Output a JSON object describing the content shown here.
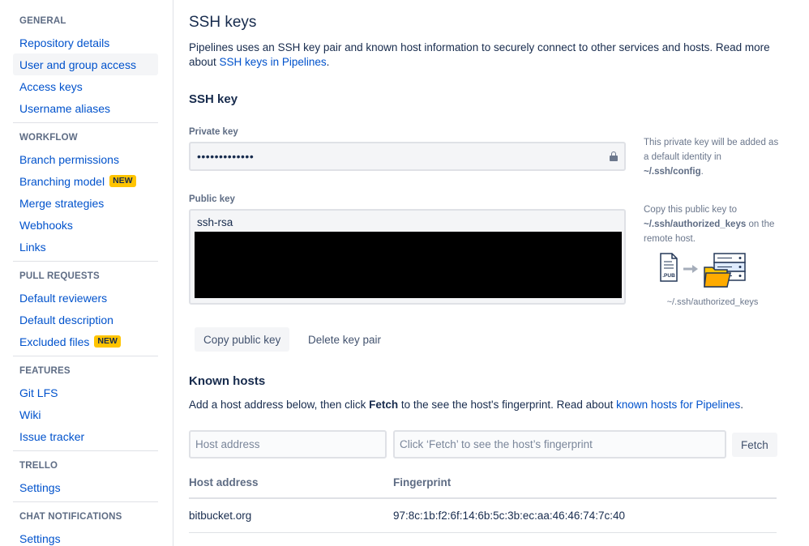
{
  "sidebar": {
    "sections": [
      {
        "heading": "GENERAL",
        "items": [
          {
            "label": "Repository details"
          },
          {
            "label": "User and group access",
            "selected": true
          },
          {
            "label": "Access keys"
          },
          {
            "label": "Username aliases"
          }
        ]
      },
      {
        "heading": "WORKFLOW",
        "items": [
          {
            "label": "Branch permissions"
          },
          {
            "label": "Branching model",
            "badge": "NEW"
          },
          {
            "label": "Merge strategies"
          },
          {
            "label": "Webhooks"
          },
          {
            "label": "Links"
          }
        ]
      },
      {
        "heading": "PULL REQUESTS",
        "items": [
          {
            "label": "Default reviewers"
          },
          {
            "label": "Default description"
          },
          {
            "label": "Excluded files",
            "badge": "NEW"
          }
        ]
      },
      {
        "heading": "FEATURES",
        "items": [
          {
            "label": "Git LFS"
          },
          {
            "label": "Wiki"
          },
          {
            "label": "Issue tracker"
          }
        ]
      },
      {
        "heading": "TRELLO",
        "items": [
          {
            "label": "Settings"
          }
        ]
      },
      {
        "heading": "CHAT NOTIFICATIONS",
        "items": [
          {
            "label": "Settings"
          }
        ]
      }
    ]
  },
  "main": {
    "title": "SSH keys",
    "intro_text": "Pipelines uses an SSH key pair and known host information to securely connect to other services and hosts. Read more about ",
    "intro_link": "SSH keys in Pipelines",
    "intro_end": ".",
    "ssh_key": {
      "title": "SSH key",
      "private_label": "Private key",
      "private_value": "•••••••••••••",
      "private_note_1": "This private key will be added as a default identity in ",
      "private_note_path": "~/.ssh/config",
      "private_note_end": ".",
      "public_label": "Public key",
      "public_value": "ssh-rsa",
      "public_note_1": "Copy this public key to ",
      "public_note_path": "~/.ssh/authorized_keys",
      "public_note_2": " on the remote host.",
      "illustration_file_label": ".PUB",
      "illustration_caption": "~/.ssh/authorized_keys",
      "copy_button": "Copy public key",
      "delete_button": "Delete key pair"
    },
    "known_hosts": {
      "title": "Known hosts",
      "desc_1": "Add a host address below, then click ",
      "desc_bold": "Fetch",
      "desc_2": " to the see the host's fingerprint. Read about ",
      "desc_link": "known hosts for Pipelines",
      "desc_end": ".",
      "host_placeholder": "Host address",
      "fingerprint_placeholder": "Click ‘Fetch’ to see the host’s fingerprint",
      "fetch_button": "Fetch",
      "columns": [
        "Host address",
        "Fingerprint"
      ],
      "rows": [
        {
          "host": "bitbucket.org",
          "fingerprint": "97:8c:1b:f2:6f:14:6b:5c:3b:ec:aa:46:46:74:7c:40"
        }
      ]
    }
  },
  "colors": {
    "link": "#0052cc",
    "badge": "#ffc400",
    "text": "#172b4d",
    "muted": "#5e6c84",
    "border": "#dfe1e6"
  }
}
